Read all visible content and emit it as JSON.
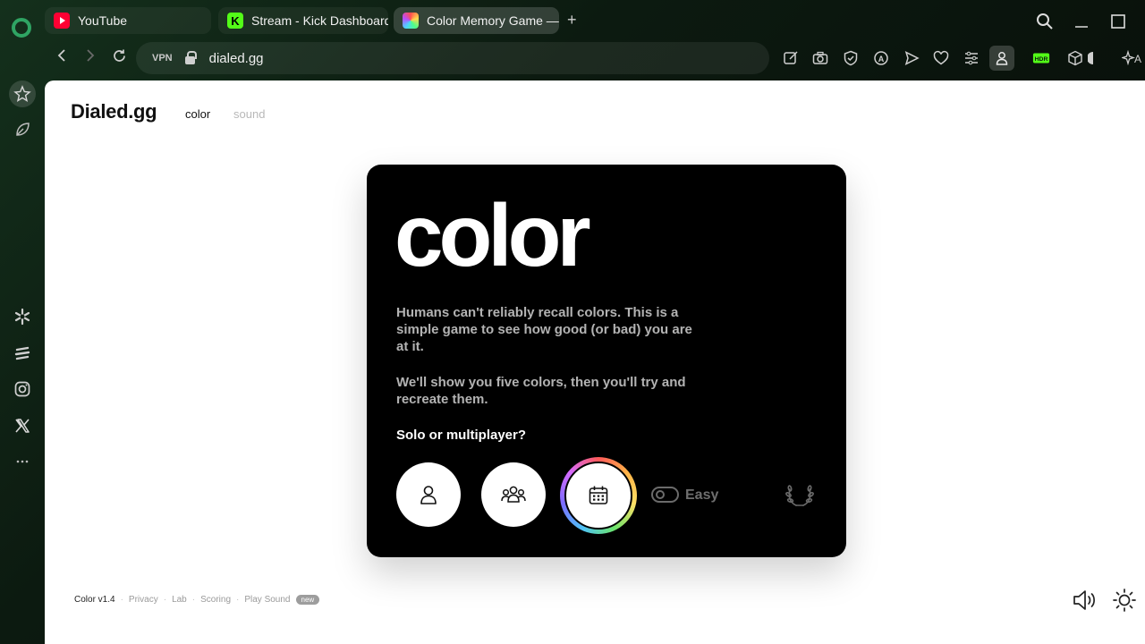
{
  "browser": {
    "tabs": [
      {
        "label": "YouTube",
        "favicon": "youtube-icon"
      },
      {
        "label": "Stream - Kick Dashboard",
        "favicon": "kick-icon",
        "favicon_letter": "K"
      },
      {
        "label": "Color Memory Game —",
        "favicon": "color-wheel-icon",
        "active": true
      }
    ],
    "new_tab": "+",
    "vpn_label": "VPN",
    "url": "dialed.gg"
  },
  "site": {
    "brand": "Dialed.gg",
    "nav": [
      {
        "label": "color",
        "active": true
      },
      {
        "label": "sound",
        "active": false
      }
    ]
  },
  "card": {
    "title": "color",
    "description_1": "Humans can't reliably recall colors. This is a simple game to see how good (or bad) you are at it.",
    "description_2": "We'll show you five colors, then you'll try and recreate them.",
    "question": "Solo or multiplayer?",
    "modes": [
      "solo-icon",
      "multiplayer-icon",
      "daily-calendar-icon"
    ],
    "difficulty_label": "Easy",
    "difficulty_enabled": false
  },
  "footer": {
    "version": "Color v1.4",
    "links": [
      "Privacy",
      "Lab",
      "Scoring",
      "Play Sound"
    ],
    "badge": "new"
  },
  "colors": {
    "accent_green": "#53fc18",
    "youtube_red": "#ff0033",
    "card_bg": "#000000",
    "page_bg": "#ffffff"
  }
}
